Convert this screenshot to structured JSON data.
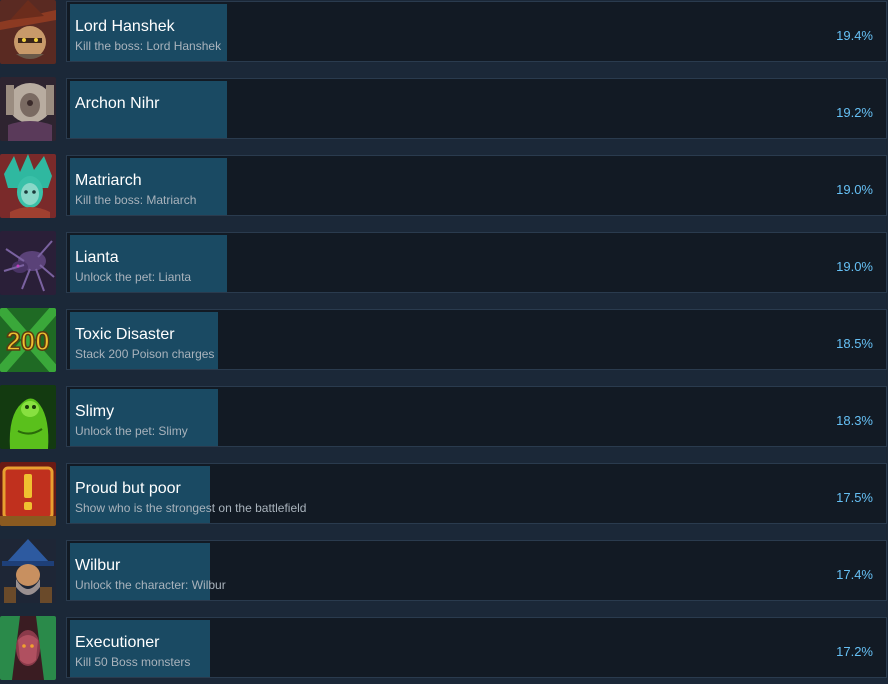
{
  "achievements": [
    {
      "name": "Lord Hanshek",
      "description": "Kill the boss: Lord Hanshek",
      "percent": "19.4%",
      "icon": "lord-hanshek-icon",
      "icon_color": "#7a3b2e"
    },
    {
      "name": "Archon Nihr",
      "description": "",
      "percent": "19.2%",
      "icon": "archon-nihr-icon",
      "icon_color": "#4b3a4a"
    },
    {
      "name": "Matriarch",
      "description": "Kill the boss: Matriarch",
      "percent": "19.0%",
      "icon": "matriarch-icon",
      "icon_color": "#2e9c8c"
    },
    {
      "name": "Lianta",
      "description": "Unlock the pet: Lianta",
      "percent": "19.0%",
      "icon": "lianta-icon",
      "icon_color": "#3e2a55"
    },
    {
      "name": "Toxic Disaster",
      "description": "Stack 200 Poison charges",
      "percent": "18.5%",
      "icon": "toxic-disaster-icon",
      "icon_color": "#2f8a2f",
      "icon_text": "200"
    },
    {
      "name": "Slimy",
      "description": "Unlock the pet: Slimy",
      "percent": "18.3%",
      "icon": "slimy-icon",
      "icon_color": "#3a8f1c"
    },
    {
      "name": "Proud but poor",
      "description": "Show who is the strongest on the battlefield",
      "percent": "17.5%",
      "icon": "proud-but-poor-icon",
      "icon_color": "#b8281e"
    },
    {
      "name": "Wilbur",
      "description": "Unlock the character: Wilbur",
      "percent": "17.4%",
      "icon": "wilbur-icon",
      "icon_color": "#2d4a7a"
    },
    {
      "name": "Executioner",
      "description": "Kill 50 Boss monsters",
      "percent": "17.2%",
      "icon": "executioner-icon",
      "icon_color": "#6a2e3a"
    }
  ]
}
